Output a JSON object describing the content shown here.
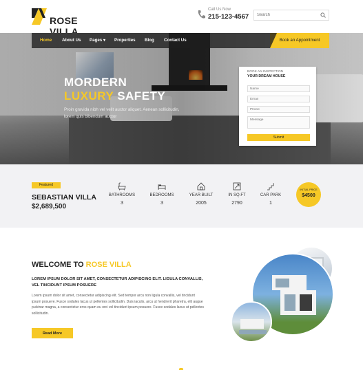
{
  "brand": {
    "name": "ROSE VILLA",
    "accent": "#f6c826"
  },
  "contact": {
    "label": "Call Us Now",
    "phone": "215-123-4567"
  },
  "search": {
    "placeholder": "Search"
  },
  "nav": {
    "items": [
      {
        "label": "Home",
        "active": true
      },
      {
        "label": "About Us"
      },
      {
        "label": "Pages ▾"
      },
      {
        "label": "Properties"
      },
      {
        "label": "Blog"
      },
      {
        "label": "Contact Us"
      }
    ],
    "cta": "Book an Appointment"
  },
  "hero": {
    "title_line1": "MORDERN",
    "title_yellow": "LUXURY",
    "title_white": " SAFETY",
    "subtitle": "Proin gravida nibh vel velit auctor aliquet. Aenean sollicitudin, lorem quis bibendum auctor"
  },
  "inspection_form": {
    "kicker": "BOOK AN INSPECTION",
    "title": "YOUR DREAM HOUSE",
    "name_placeholder": "Name",
    "email_placeholder": "Email",
    "phone_placeholder": "Phone",
    "message_placeholder": "Message",
    "submit_label": "Submit"
  },
  "featured": {
    "badge": "Featured",
    "name": "SEBASTIAN VILLA",
    "price": "$2,689,500",
    "stats": [
      {
        "icon": "bathtub-icon",
        "label": "BATHROOMS",
        "value": "3"
      },
      {
        "icon": "bed-icon",
        "label": "BEDROOMS",
        "value": "3"
      },
      {
        "icon": "house-icon",
        "label": "YEAR BUILT",
        "value": "2005"
      },
      {
        "icon": "area-icon",
        "label": "IN SQ.FT",
        "value": "2790"
      },
      {
        "icon": "stairs-icon",
        "label": "CAR PARK",
        "value": "1"
      }
    ],
    "initial_price_label": "INITIAL PRICE",
    "initial_price": "$4500"
  },
  "welcome": {
    "title_dark": "WELCOME TO ",
    "title_yellow": "ROSE VILLA",
    "lead": "LOREM IPSUM DOLOR SIT AMET, CONSECTETUR ADIPISCING ELIT. LIGULA CONVALLIS, VEL TINCIDUNT IPSUM POSUERE",
    "body": "Lorem ipsum dolor sit amet, consectetur adipiscing elit. Sed tempor arcu non ligula convallis, vel tincidunt ipsum posuere. Fusce sodales lacus ut pellentes sollicitudin. Duis iaculis, arcu ut hendrerit pharetra, elit augue pulvinar magna, a consectetur eros quam eu orci vel tincidunt ipsum posuere. Fusce sodales lacus ut pellentes sollicitudin.",
    "button": "Read More"
  }
}
